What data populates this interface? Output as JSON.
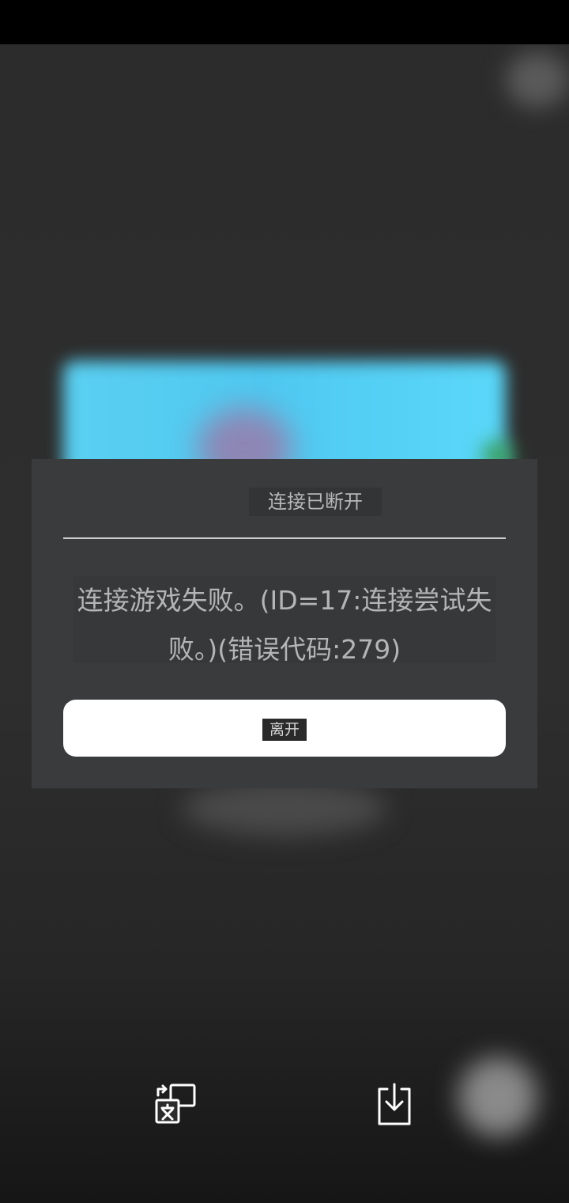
{
  "dialog": {
    "title": "连接已断开",
    "message": "连接游戏失败。(ID=17:连接尝试失败。)(错误代码:279)",
    "leave_label": "离开"
  },
  "icons": {
    "translate": "translate-icon",
    "download": "download-icon"
  },
  "colors": {
    "dialog_background": "#3a3b3d",
    "button_background": "#ffffff",
    "banner_accent": "#5ad0f2"
  }
}
